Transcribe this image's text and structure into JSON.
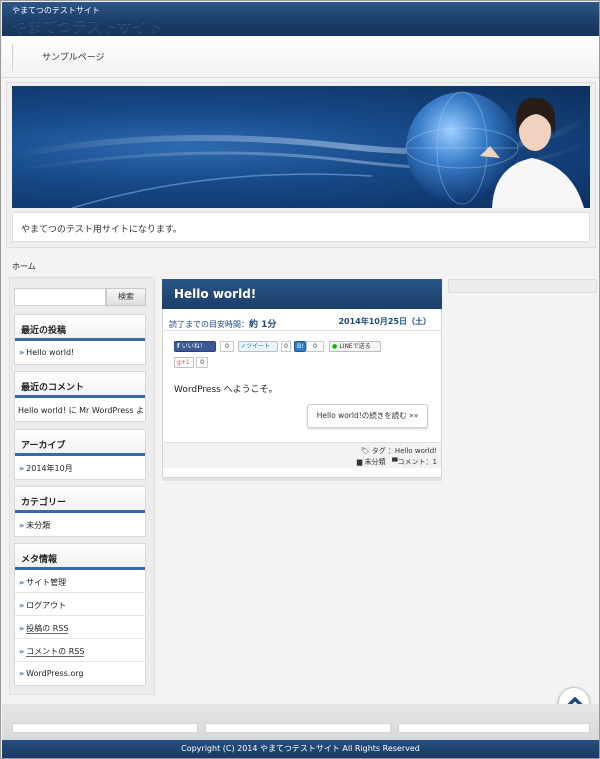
{
  "site": {
    "tagline": "やまてつのテストサイト",
    "logo": "やまてつテストサイト",
    "description": "やまてつのテスト用サイトになります。"
  },
  "nav": {
    "items": [
      "サンプルページ"
    ]
  },
  "breadcrumb": "ホーム",
  "sidebar": {
    "search_button": "検索",
    "search_placeholder": "",
    "widgets": [
      {
        "title": "最近の投稿",
        "items": [
          "Hello world!"
        ]
      },
      {
        "title": "最近のコメント",
        "items": [
          "Hello world! に Mr WordPress より"
        ]
      },
      {
        "title": "アーカイブ",
        "items": [
          "2014年10月"
        ]
      },
      {
        "title": "カテゴリー",
        "items": [
          "未分類"
        ]
      },
      {
        "title": "メタ情報",
        "items": [
          "サイト管理",
          "ログアウト",
          "投稿の RSS",
          "コメントの RSS",
          "WordPress.org"
        ]
      }
    ]
  },
  "post": {
    "title": "Hello world!",
    "reading_label": "読了までの目安時間：",
    "reading_value": "約 1分",
    "date": "2014年10月25日（土）",
    "content": "WordPress へようこそ。",
    "more": "Hello world!の続きを読む »»",
    "tag_label": "タグ",
    "tag_value": "：Hello world!",
    "category": "未分類",
    "comments": "コメント：1",
    "social": {
      "facebook_label": "いいね！",
      "facebook_count": "0",
      "twitter_label": "ツイート",
      "twitter_count": "0",
      "hatena_label": "B!",
      "hatena_count": "0",
      "line_label": "LINEで送る",
      "gplus_label": "g+1",
      "gplus_count": "0"
    }
  },
  "footer": {
    "copyright": "Copyright (C) 2014 やまてつテストサイト  All Rights Reserved"
  },
  "colors": {
    "brand_blue": "#1c3e6a",
    "accent_blue": "#3a6aa4",
    "background": "#f3f3f3"
  },
  "icons": [
    "tag-icon",
    "folder-icon",
    "comment-icon",
    "chevron-up-icon",
    "facebook-icon",
    "twitter-icon",
    "hatena-icon",
    "line-icon",
    "gplus-icon"
  ]
}
